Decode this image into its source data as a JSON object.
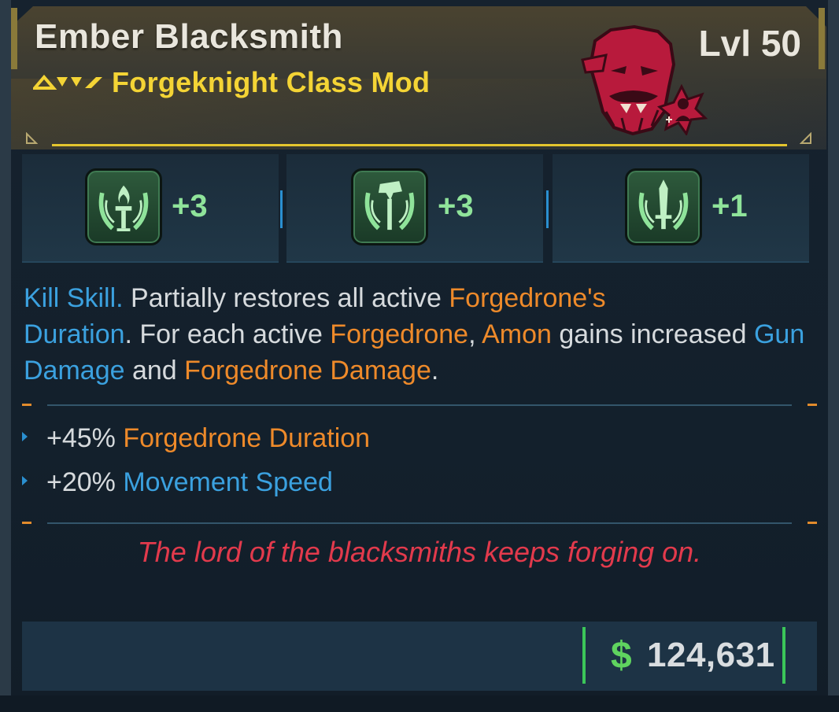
{
  "item": {
    "name": "Ember Blacksmith",
    "subtitle": "Forgeknight Class Mod",
    "level": "Lvl 50",
    "rarity_icon": "legendary-chevrons-icon",
    "portrait_icon": "red-bearded-face-icon",
    "colors": {
      "title": "#e9e6dd",
      "subtitle": "#f4d435",
      "accent_gold": "#e4c52e",
      "skill_bonus": "#8fe39a",
      "keyword_blue": "#3ba1df",
      "keyword_orange": "#ee8a2a",
      "flavor": "#e23a4c",
      "currency": "#5fd35f"
    }
  },
  "skills": [
    {
      "icon": "flame-torch-skill-icon",
      "bonus": "+3"
    },
    {
      "icon": "hammer-skill-icon",
      "bonus": "+3"
    },
    {
      "icon": "sword-skill-icon",
      "bonus": "+1"
    }
  ],
  "description": {
    "kill_skill": "Kill Skill.",
    "t1": " Partially restores all active ",
    "forgedrone_s": "Forgedrone's",
    "duration": "Duration",
    "t2": ". For each active ",
    "forgedrone": "Forgedrone",
    "comma": ", ",
    "amon": "Amon",
    "t3": " gains increased ",
    "gun_damage": "Gun Damage",
    "and": " and ",
    "forgedrone_damage": "Forgedrone Damage",
    "period": "."
  },
  "stats": [
    {
      "value": "+45%",
      "label": "Forgedrone Duration"
    },
    {
      "value": "+20%",
      "label": "Movement Speed"
    }
  ],
  "flavor_text": "The lord of the blacksmiths keeps forging on.",
  "price": {
    "symbol": "$",
    "value": "124,631"
  }
}
